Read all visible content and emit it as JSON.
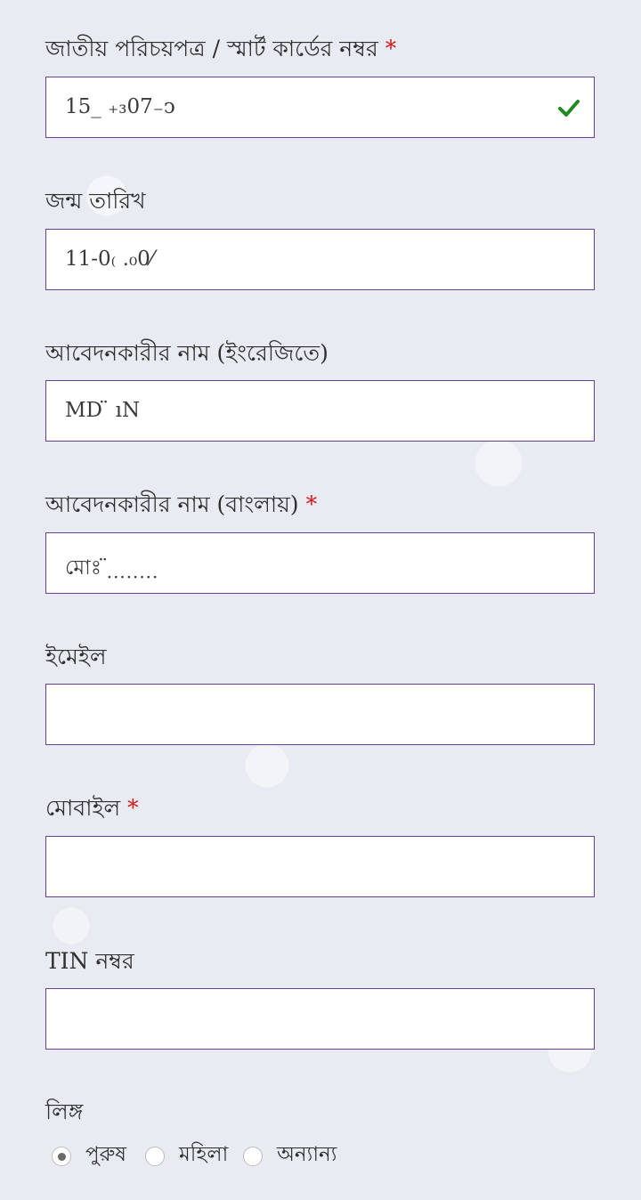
{
  "form": {
    "nid": {
      "label": "জাতীয় পরিচয়পত্র / স্মার্ট কার্ডের নম্বর",
      "required_mark": "*",
      "value": "15_ ₊₃07₋ͻ"
    },
    "dob": {
      "label": "জন্ম তারিখ",
      "value": "11-0₍ .₀0⁄"
    },
    "name_en": {
      "label": "আবেদনকারীর নাম (ইংরেজিতে)",
      "value": "MD  ̈                  ıN"
    },
    "name_bn": {
      "label": "আবেদনকারীর নাম (বাংলায়)",
      "required_mark": "*",
      "value": "মোঃ  ̈ ̣ ̣ ̣ ̣ ̣ ̣ ̣ ̣"
    },
    "email": {
      "label": "ইমেইল",
      "value": ""
    },
    "mobile": {
      "label": "মোবাইল",
      "required_mark": "*",
      "value": ""
    },
    "tin": {
      "label": "TIN নম্বর",
      "value": ""
    },
    "gender": {
      "label": "লিঙ্গ",
      "options": [
        "পুরুষ",
        "মহিলা",
        "অন্যান্য"
      ],
      "selected": "পুরুষ"
    }
  },
  "colors": {
    "border": "#6a3f91",
    "required": "#d41919",
    "valid_check": "#1f8a1f"
  },
  "icons": {
    "valid": "check-icon"
  }
}
